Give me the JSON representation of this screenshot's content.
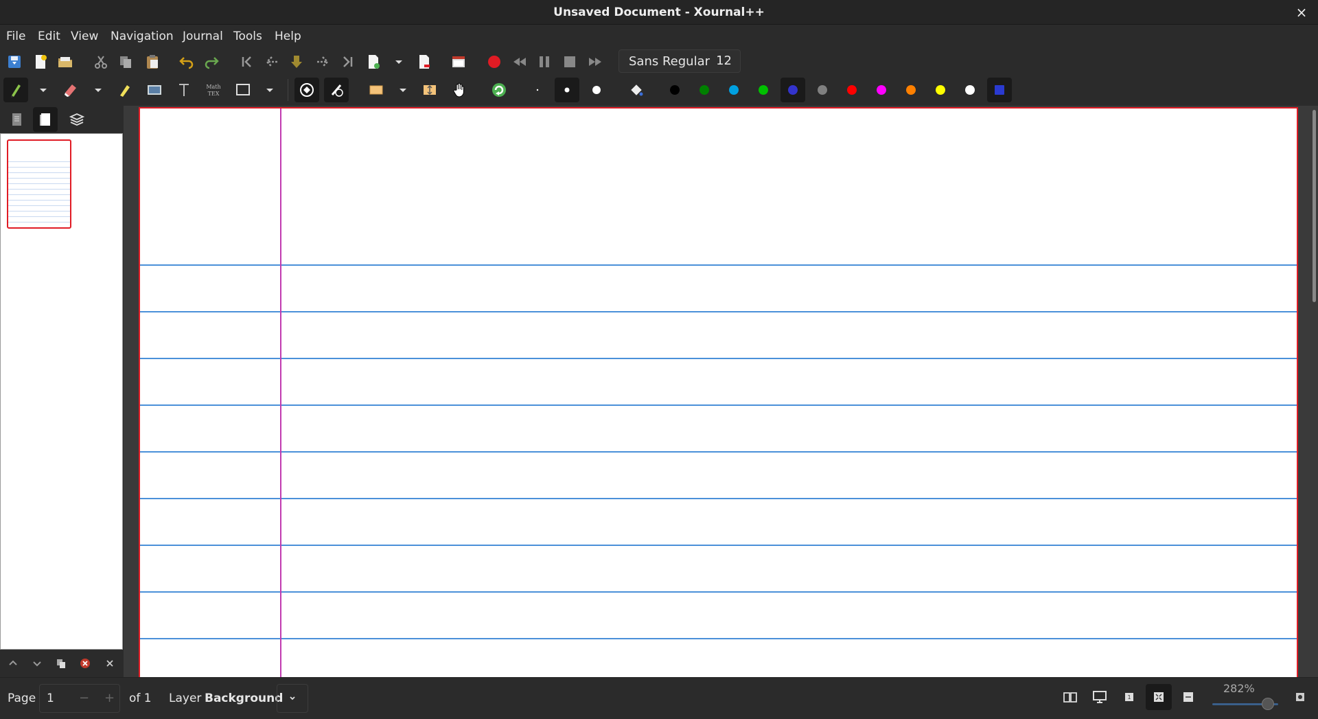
{
  "window": {
    "title": "Unsaved Document - Xournal++",
    "close_glyph": "×"
  },
  "menu": [
    "File",
    "Edit",
    "View",
    "Navigation",
    "Journal",
    "Tools",
    "Help"
  ],
  "toolbar": {
    "font_name": "Sans Regular",
    "font_size": "12",
    "colors": [
      "#000000",
      "#008000",
      "#00a0e0",
      "#00c000",
      "#3333cc",
      "#808080",
      "#ff0000",
      "#ff00ff",
      "#ff8000",
      "#ffff00",
      "#ffffff"
    ],
    "selected_color": "#3333cc",
    "custom_color": "#2a3ad0"
  },
  "statusbar": {
    "page_label": "Page",
    "page_value": "1",
    "page_minus": "−",
    "page_plus": "+",
    "page_of": "of 1",
    "layer_label": "Layer",
    "layer_value": "Background",
    "zoom": "282%"
  },
  "page_style": {
    "border_color": "#e01b24",
    "rule_color": "#4a90d9",
    "margin_color": "#c03ab0"
  }
}
